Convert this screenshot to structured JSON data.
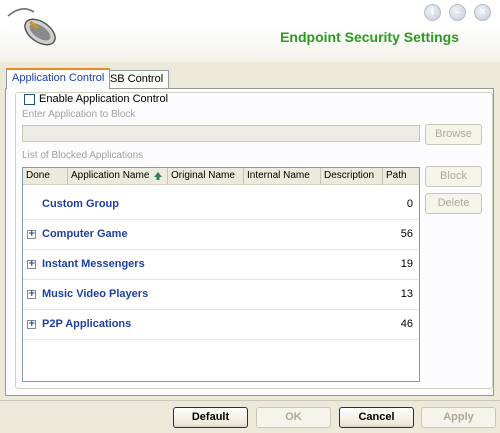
{
  "header": {
    "title": "Endpoint Security Settings",
    "logo_icon": "mouse-icon",
    "window_buttons": [
      {
        "icon": "info-icon",
        "label": "i"
      },
      {
        "icon": "minimize-icon",
        "label": "–"
      },
      {
        "icon": "close-icon",
        "label": "✕"
      }
    ]
  },
  "tabs": [
    {
      "label": "Application Control",
      "active": true
    },
    {
      "label": "USB Control",
      "active": false
    }
  ],
  "app_control": {
    "enable_label": "Enable Application Control",
    "enable_checked": false,
    "enter_label": "Enter Application to Block",
    "app_input_value": "",
    "browse_label": "Browse",
    "list_label": "List of Blocked Applications",
    "block_label": "Block",
    "delete_label": "Delete"
  },
  "list": {
    "columns": [
      "Done",
      "Application Name",
      "Original Name",
      "Internal Name",
      "Description",
      "Path"
    ],
    "sort_icon": "sort-up-arrow-icon",
    "rows": [
      {
        "name": "Custom Group",
        "count": "0",
        "expandable": false
      },
      {
        "name": "Computer Game",
        "count": "56",
        "expandable": true
      },
      {
        "name": "Instant Messengers",
        "count": "19",
        "expandable": true
      },
      {
        "name": "Music Video Players",
        "count": "13",
        "expandable": true
      },
      {
        "name": "P2P Applications",
        "count": "46",
        "expandable": true
      }
    ]
  },
  "footer": {
    "default_label": "Default",
    "ok_label": "OK",
    "cancel_label": "Cancel",
    "apply_label": "Apply"
  },
  "colors": {
    "title": "#2b9a20",
    "row_text": "#1d3fa1",
    "background": "#ece9d8"
  }
}
